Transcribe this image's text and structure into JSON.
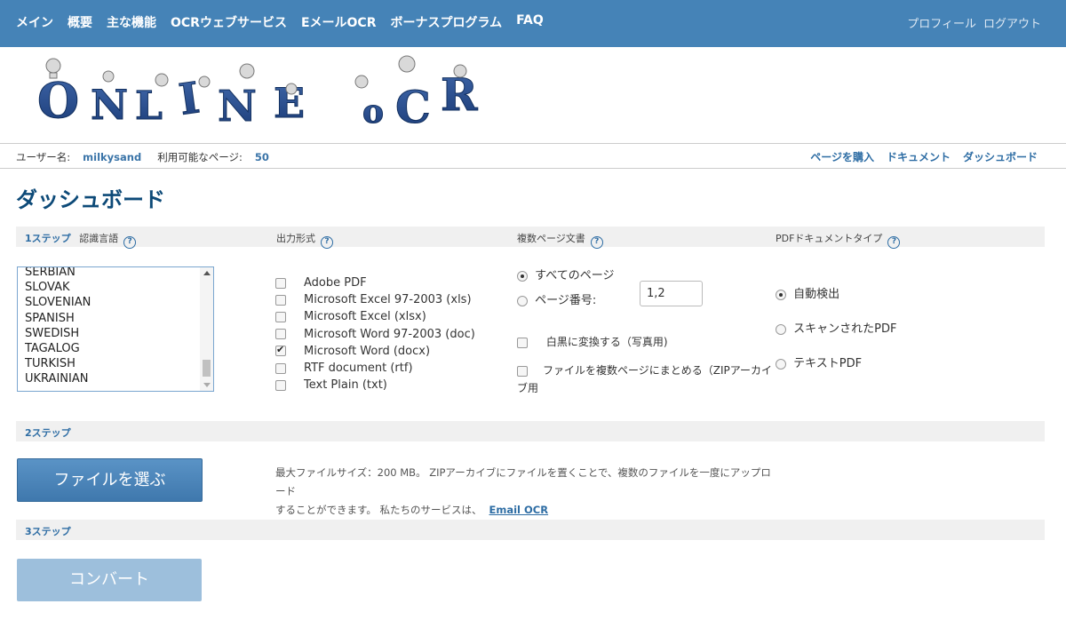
{
  "nav": {
    "left": [
      "メイン",
      "概要",
      "主な機能",
      "OCRウェブサービス",
      "EメールOCR",
      "ボーナスプログラム",
      "FAQ"
    ],
    "profile": "プロフィール",
    "logout": "ログアウト"
  },
  "logo": {
    "text": "ONLINE OCR"
  },
  "userbar": {
    "username_label": "ユーザー名:",
    "username": "milkysand",
    "pages_label": "利用可能なページ:",
    "pages": "50",
    "buy_pages": "ページを購入",
    "documents": "ドキュメント",
    "dashboard": "ダッシュボード"
  },
  "page_title": "ダッシュボード",
  "step1": {
    "step": "1ステップ",
    "language_label": "認識言語",
    "output_label": "出力形式",
    "multipage_label": "複数ページ文書",
    "pdftype_label": "PDFドキュメントタイプ",
    "help": "?"
  },
  "languages": [
    "SERBIAN",
    "SLOVAK",
    "SLOVENIAN",
    "SPANISH",
    "SWEDISH",
    "TAGALOG",
    "TURKISH",
    "UKRAINIAN"
  ],
  "formats": [
    {
      "label": "Adobe PDF",
      "checked": false
    },
    {
      "label": "Microsoft Excel 97-2003 (xls)",
      "checked": false
    },
    {
      "label": "Microsoft Excel (xlsx)",
      "checked": false
    },
    {
      "label": "Microsoft Word 97-2003 (doc)",
      "checked": false
    },
    {
      "label": "Microsoft Word (docx)",
      "checked": true
    },
    {
      "label": "RTF document (rtf)",
      "checked": false
    },
    {
      "label": "Text Plain (txt)",
      "checked": false
    }
  ],
  "multipage": {
    "all_pages": "すべてのページ",
    "page_numbers": "ページ番号:",
    "page_numbers_value": "1,2",
    "bw": "白黒に変換する（写真用)",
    "zip_line1": "ファイルを複数ページにまとめる（ZIPアーカイ",
    "zip_line2": "ブ用"
  },
  "pdftype": {
    "auto": "自動検出",
    "scanned": "スキャンされたPDF",
    "text": "テキストPDF"
  },
  "step2": {
    "step": "2ステップ",
    "choose_file": "ファイルを選ぶ",
    "note_line1": "最大ファイルサイズ：200 MB。 ZIPアーカイブにファイルを置くことで、複数のファイルを一度にアップロード",
    "note_line2": "することができます。 私たちのサービスは、",
    "email_ocr": "Email OCR"
  },
  "step3": {
    "step": "3ステップ",
    "convert": "コンバート"
  }
}
